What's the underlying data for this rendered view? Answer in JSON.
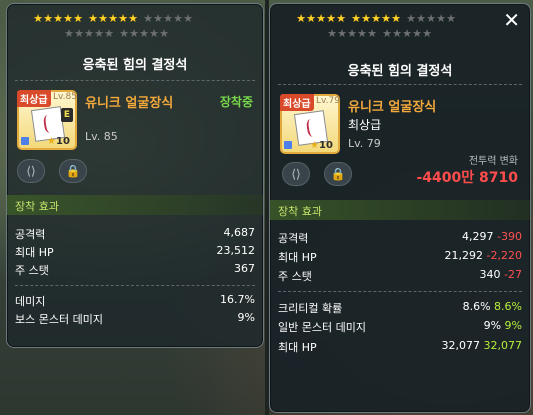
{
  "left_panel": {
    "stars": {
      "row1_on": 10,
      "row1_off": 5,
      "row2_off": 10
    },
    "title": "응축된 힘의 결정석",
    "item": {
      "grade_tag": "최상급",
      "name": "유니크 얼굴장식",
      "level": "Lv. 85",
      "icon_level": "Lv.85",
      "badge": "E",
      "star_count": "10",
      "status": "장착중"
    },
    "buttons": {
      "share_label": "share-icon",
      "lock_label": "lock-icon"
    },
    "section": "장착 효과",
    "stats": [
      {
        "key": "공격력",
        "value": "4,687"
      },
      {
        "key": "최대 HP",
        "value": "23,512"
      },
      {
        "key": "주 스탯",
        "value": "367"
      },
      {
        "key": "데미지",
        "value": "16.7%"
      },
      {
        "key": "보스 몬스터 데미지",
        "value": "9%"
      }
    ]
  },
  "right_panel": {
    "stars": {
      "row1_on": 10,
      "row1_off": 5,
      "row2_off": 10
    },
    "title": "응축된 힘의 결정석",
    "item": {
      "grade_tag": "최상급",
      "name": "유니크 얼굴장식",
      "grade": "최상급",
      "level": "Lv. 79",
      "icon_level": "Lv.79",
      "star_count": "10"
    },
    "power": {
      "label": "전투력 변화",
      "value": "-4400만 8710"
    },
    "section": "장착 효과",
    "stats": [
      {
        "key": "공격력",
        "value": "4,297",
        "diff": "-390",
        "diff_type": "neg"
      },
      {
        "key": "최대 HP",
        "value": "21,292",
        "diff": "-2,220",
        "diff_type": "neg"
      },
      {
        "key": "주 스탯",
        "value": "340",
        "diff": "-27",
        "diff_type": "neg"
      },
      {
        "key": "크리티컬 확률",
        "value": "8.6%",
        "diff": "8.6%",
        "diff_type": "pos"
      },
      {
        "key": "일반 몬스터 데미지",
        "value": "9%",
        "diff": "9%",
        "diff_type": "pos"
      },
      {
        "key": "최대 HP",
        "value": "32,077",
        "diff": "32,077",
        "diff_type": "pos"
      }
    ],
    "close_label": "✕"
  },
  "colors": {
    "item_name": "#f3a83c",
    "equipped": "#78d84a",
    "negative": "#ff5050",
    "positive": "#b7f03a",
    "section": "#c6e36b"
  }
}
